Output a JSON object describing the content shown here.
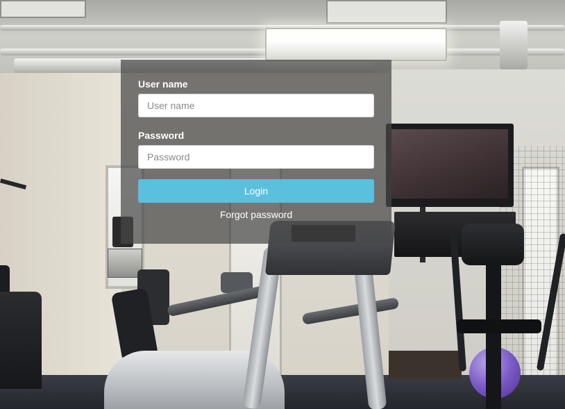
{
  "login": {
    "username_label": "User name",
    "username_placeholder": "User name",
    "username_value": "",
    "password_label": "Password",
    "password_placeholder": "Password",
    "password_value": "",
    "login_button": "Login",
    "forgot_password": "Forgot password"
  },
  "colors": {
    "panel_overlay": "rgba(72,72,72,0.72)",
    "login_button": "#5bc0de",
    "label_text": "#ffffff"
  },
  "background": {
    "icon": "gym-photo"
  }
}
